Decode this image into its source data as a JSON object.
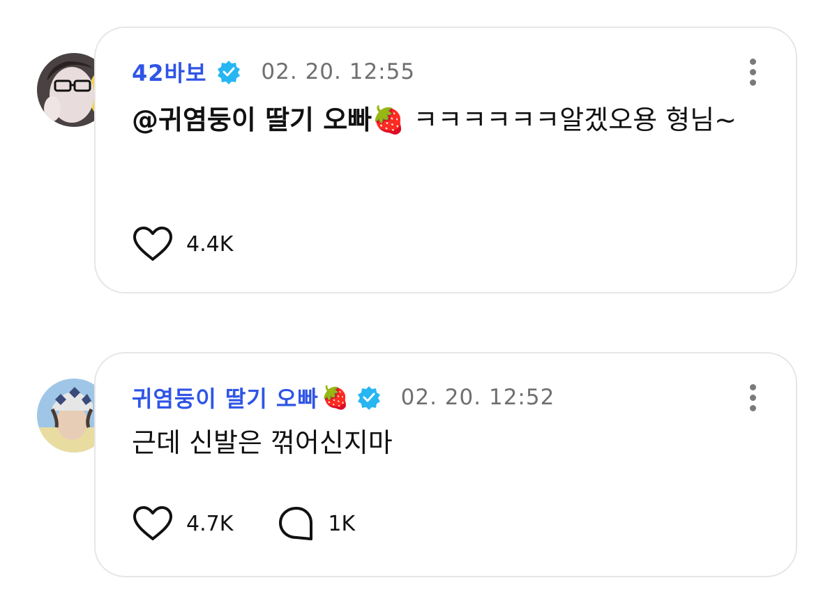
{
  "comments": [
    {
      "username": "42바보",
      "username_emoji": "",
      "verified": true,
      "timestamp": "02. 20. 12:55",
      "mention": "@귀염둥이 딸기 오빠🍓",
      "text": " ㅋㅋㅋㅋㅋㅋ알겠오용 형님~",
      "likes": "4.4K",
      "replies": null,
      "avatar_icon": "profile-photo-glasses"
    },
    {
      "username": "귀염둥이 딸기 오빠",
      "username_emoji": "🍓",
      "verified": true,
      "timestamp": "02. 20. 12:52",
      "mention": "",
      "text": "근데 신발은 꺾어신지마",
      "likes": "4.7K",
      "replies": "1K",
      "avatar_icon": "profile-photo-beanie"
    }
  ],
  "colors": {
    "username": "#2f55e6",
    "verified_badge": "#27b6f2",
    "timestamp": "#6f6f6f",
    "card_border": "#e6e6e6"
  },
  "icons": {
    "like": "heart-outline-icon",
    "reply": "speech-bubble-outline-icon",
    "more": "vertical-ellipsis-icon",
    "verified": "verified-badge-icon"
  }
}
